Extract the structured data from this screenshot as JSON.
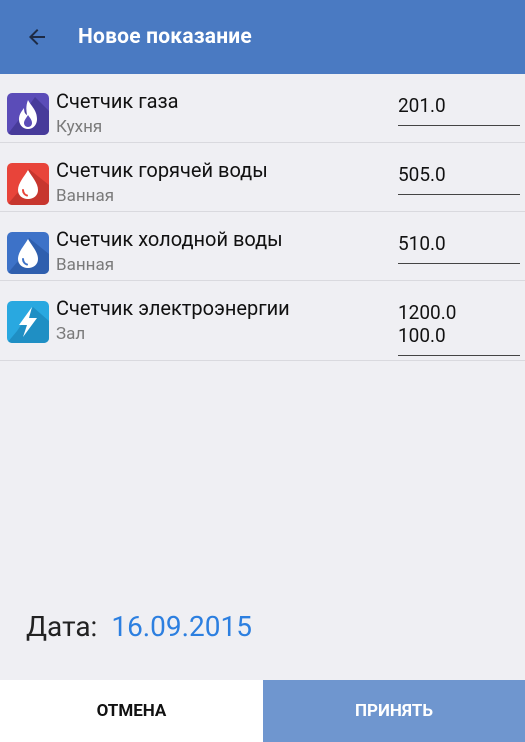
{
  "header": {
    "title": "Новое показание",
    "back_icon": "arrow-left-icon",
    "color": "#4a7ac2"
  },
  "meters": [
    {
      "name": "Счетчик газа",
      "place": "Кухня",
      "values": [
        "201.0"
      ],
      "icon": "flame-icon",
      "icon_color": "#5b4cb8"
    },
    {
      "name": "Счетчик горячей воды",
      "place": "Ванная",
      "values": [
        "505.0"
      ],
      "icon": "water-drop-icon",
      "icon_color": "#e8443a"
    },
    {
      "name": "Счетчик холодной воды",
      "place": "Ванная",
      "values": [
        "510.0"
      ],
      "icon": "water-drop-icon",
      "icon_color": "#3d72c8"
    },
    {
      "name": "Счетчик электроэнергии",
      "place": "Зал",
      "values": [
        "1200.0",
        "100.0"
      ],
      "icon": "lightning-icon",
      "icon_color": "#29a8e0"
    }
  ],
  "date": {
    "label": "Дата:",
    "value": "16.09.2015",
    "color": "#2c7fe0"
  },
  "buttons": {
    "cancel": "ОТМЕНА",
    "accept": "ПРИНЯТЬ"
  }
}
